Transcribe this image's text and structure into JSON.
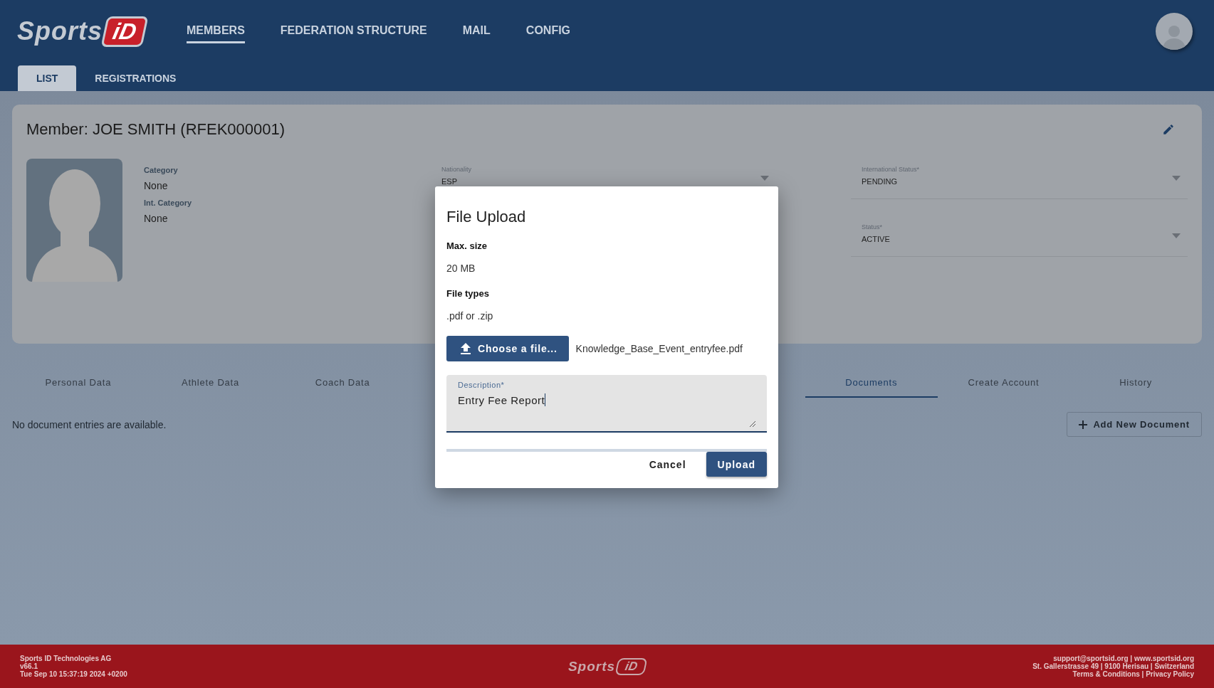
{
  "header": {
    "logo": {
      "word": "Sports",
      "mark": "iD"
    },
    "nav": [
      {
        "label": "MEMBERS",
        "selected": true
      },
      {
        "label": "FEDERATION STRUCTURE",
        "selected": false
      },
      {
        "label": "MAIL",
        "selected": false
      },
      {
        "label": "CONFIG",
        "selected": false
      }
    ],
    "subtabs": [
      {
        "label": "LIST",
        "selected": true
      },
      {
        "label": "REGISTRATIONS",
        "selected": false
      }
    ]
  },
  "member": {
    "title": "Member: JOE SMITH (RFEK000001)",
    "info": [
      {
        "label": "Category",
        "value": "None"
      },
      {
        "label": "Int. Category",
        "value": "None"
      }
    ],
    "nationality": {
      "label": "Nationality",
      "value": "ESP"
    },
    "selects": [
      {
        "label": "International Status*",
        "value": "PENDING"
      },
      {
        "label": "Status*",
        "value": "ACTIVE"
      }
    ]
  },
  "tabs": [
    {
      "label": "Personal Data",
      "selected": false
    },
    {
      "label": "Athlete Data",
      "selected": false
    },
    {
      "label": "Coach Data",
      "selected": false
    },
    {
      "label": "Documents",
      "selected": true
    },
    {
      "label": "Create Account",
      "selected": false
    },
    {
      "label": "History",
      "selected": false
    }
  ],
  "documents": {
    "empty_text": "No document entries are available.",
    "add_button": "Add New Document"
  },
  "dialog": {
    "title": "File Upload",
    "max_size_label": "Max. size",
    "max_size": "20 MB",
    "file_types_label": "File types",
    "file_types": ".pdf or .zip",
    "choose_button": "Choose a file...",
    "file_name": "Knowledge_Base_Event_entryfee.pdf",
    "description": {
      "label": "Description*",
      "value": "Entry Fee Report"
    },
    "buttons": [
      {
        "label": "Cancel",
        "kind": "text"
      },
      {
        "label": "Upload",
        "kind": "primary"
      }
    ]
  },
  "footer": {
    "left": [
      "Sports ID Technologies AG",
      "v66.1",
      "Tue Sep 10 15:37:19 2024 +0200"
    ],
    "logo": {
      "word": "Sports",
      "mark": "iD"
    },
    "right": [
      "support@sportsid.org | www.sportsid.org",
      "St. Gallerstrasse 49 | 9100 Herisau | Switzerland",
      "Terms & Conditions | Privacy Policy"
    ]
  }
}
